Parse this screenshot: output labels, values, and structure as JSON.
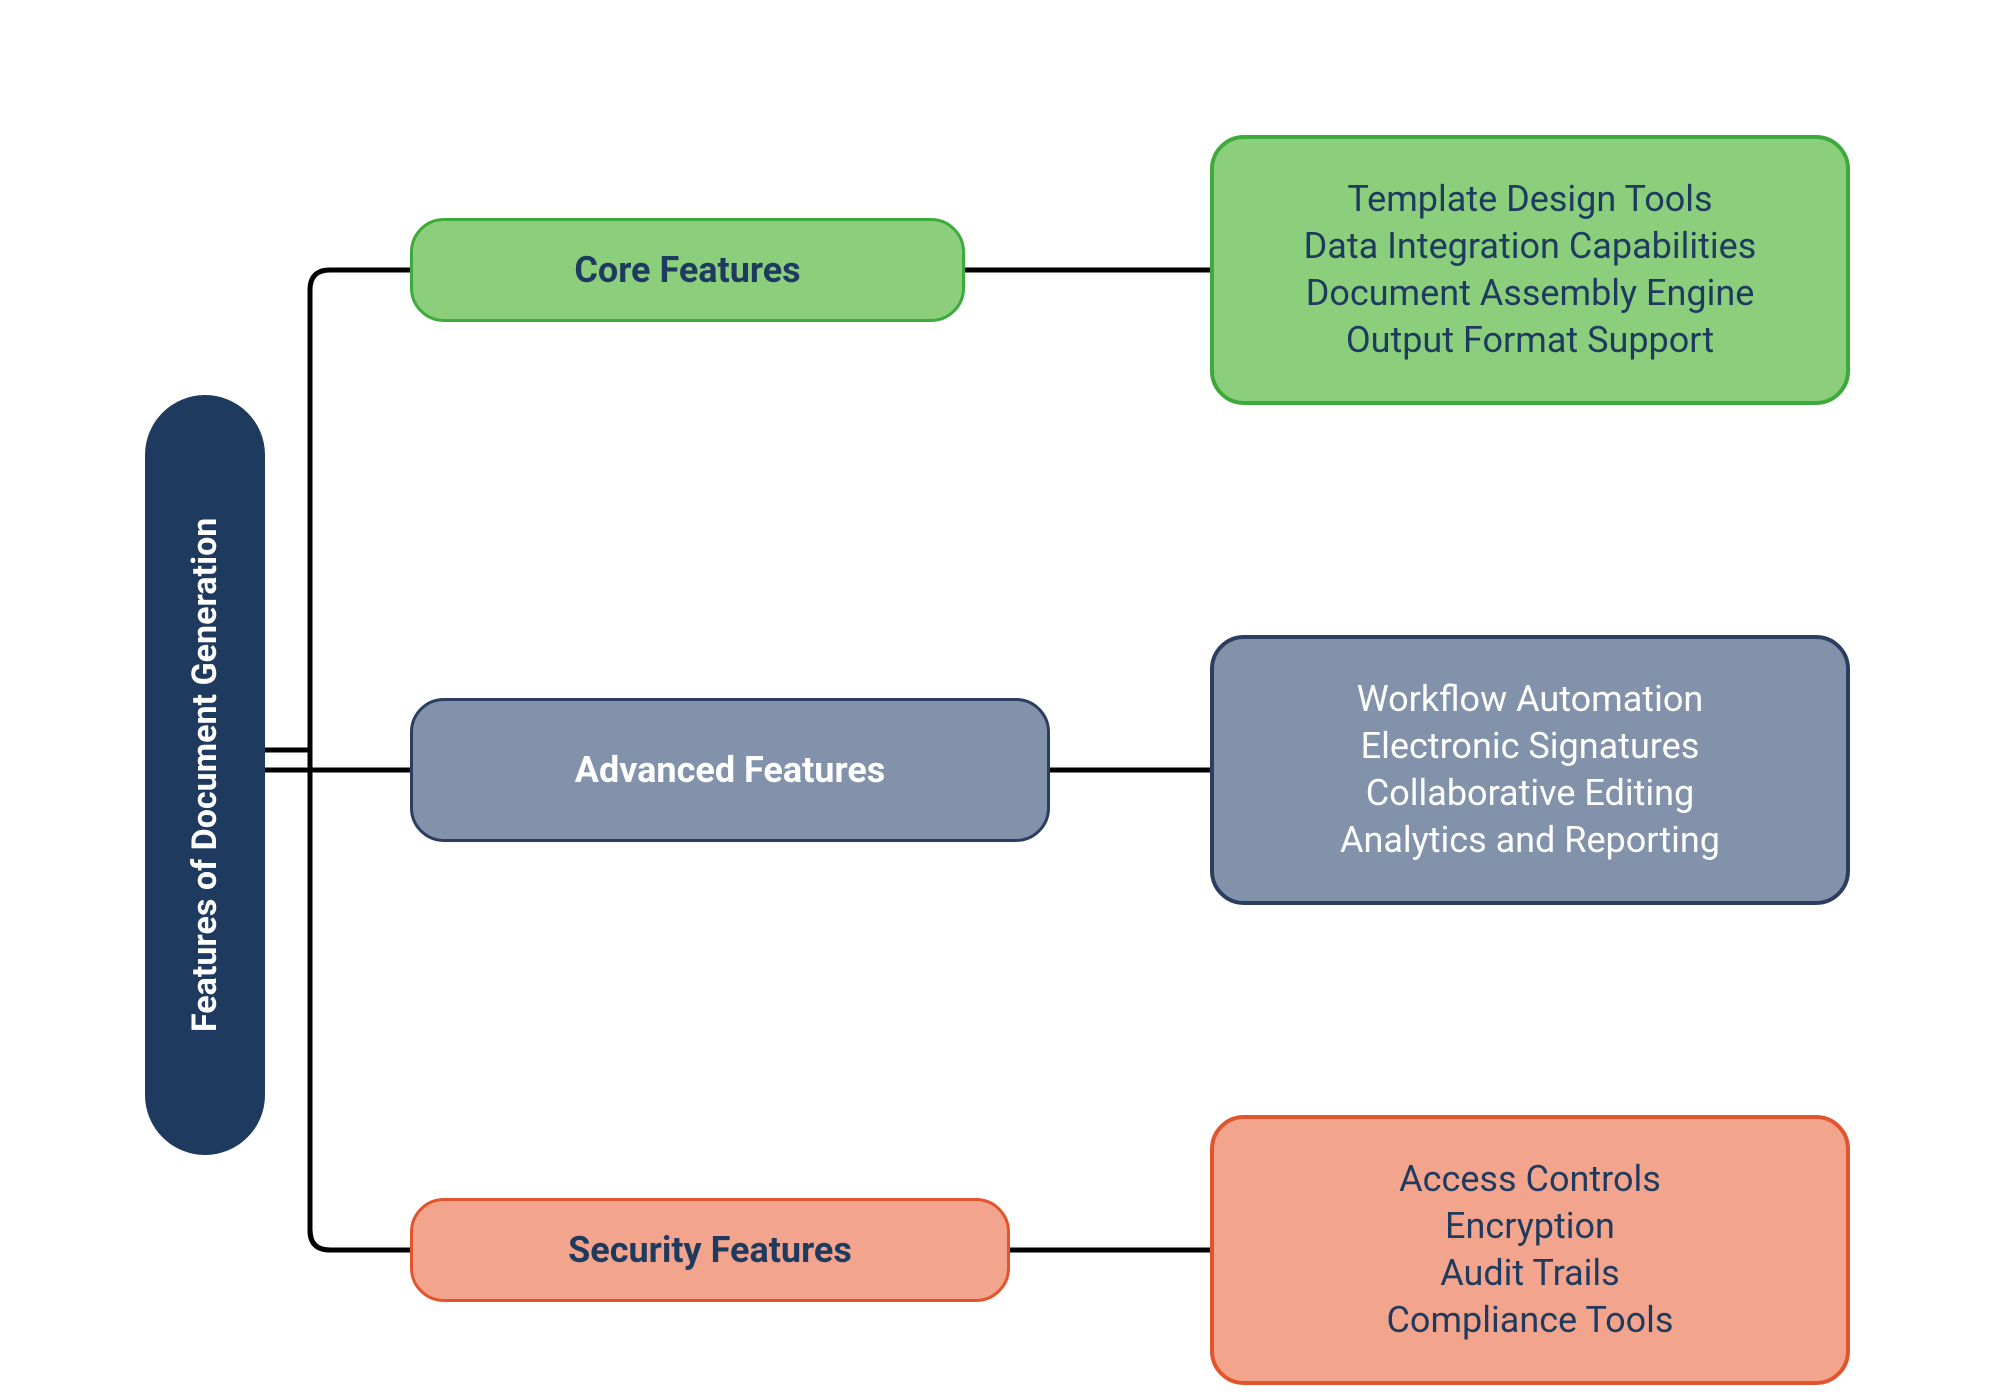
{
  "root": {
    "label": "Features of Document Generation"
  },
  "branches": [
    {
      "label": "Core Features",
      "color": "green",
      "items": [
        "Template Design Tools",
        "Data Integration Capabilities",
        "Document Assembly Engine",
        "Output Format Support"
      ]
    },
    {
      "label": "Advanced Features",
      "color": "gray",
      "items": [
        "Workflow Automation",
        "Electronic Signatures",
        "Collaborative Editing",
        "Analytics and Reporting"
      ]
    },
    {
      "label": "Security Features",
      "color": "orange",
      "items": [
        "Access Controls",
        "Encryption",
        "Audit Trails",
        "Compliance Tools"
      ]
    }
  ]
}
